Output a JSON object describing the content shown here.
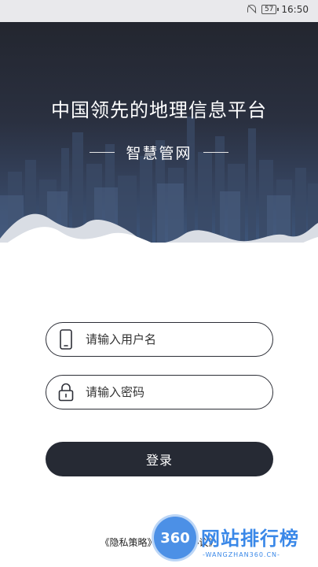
{
  "status_bar": {
    "battery_level": "57",
    "time": "16:50",
    "icons": [
      "bell-off-icon",
      "battery-icon"
    ]
  },
  "hero": {
    "title": "中国领先的地理信息平台",
    "subtitle": "智慧管网"
  },
  "login_form": {
    "username_placeholder": "请输入用户名",
    "password_placeholder": "请输入密码",
    "username_icon": "phone-icon",
    "password_icon": "lock-icon",
    "submit_label": "登录"
  },
  "footer": {
    "privacy_link": "《隐私策略》",
    "agreement_link": "《用户协议》"
  },
  "watermark": {
    "badge": "360",
    "text": "网站排行榜",
    "subtext": "-WANGZHAN360.CN-"
  },
  "colors": {
    "hero_top": "#23262f",
    "hero_bottom": "#3d5579",
    "button": "#262a34",
    "watermark": "#3a88e8"
  }
}
